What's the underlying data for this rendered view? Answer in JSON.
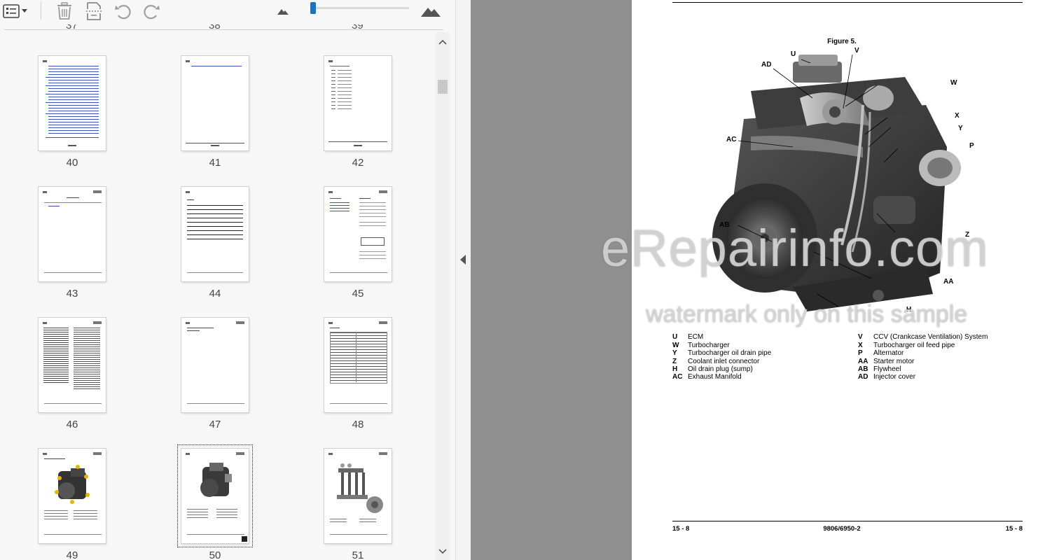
{
  "toolbar": {
    "icons": [
      "list-view-icon",
      "dropdown-caret-icon",
      "delete-icon",
      "extract-page-icon",
      "rotate-left-icon",
      "rotate-right-icon",
      "zoom-out-icon",
      "zoom-in-icon"
    ],
    "zoom_level": 0.02
  },
  "thumbnails": {
    "partial_numbers": [
      "37",
      "38",
      "39"
    ],
    "pages": [
      {
        "number": "40"
      },
      {
        "number": "41"
      },
      {
        "number": "42"
      },
      {
        "number": "43"
      },
      {
        "number": "44"
      },
      {
        "number": "45"
      },
      {
        "number": "46"
      },
      {
        "number": "47"
      },
      {
        "number": "48"
      },
      {
        "number": "49"
      },
      {
        "number": "50"
      },
      {
        "number": "51"
      }
    ],
    "selected": "50"
  },
  "document": {
    "figure_title": "Figure 5.",
    "callouts": [
      "U",
      "V",
      "AD",
      "W",
      "X",
      "Y",
      "AC",
      "P",
      "AB",
      "Z",
      "AA",
      "H"
    ],
    "legend": [
      {
        "code": "U",
        "label": "ECM"
      },
      {
        "code": "W",
        "label": "Turbocharger"
      },
      {
        "code": "Y",
        "label": "Turbocharger oil drain pipe"
      },
      {
        "code": "Z",
        "label": "Coolant inlet connector"
      },
      {
        "code": "H",
        "label": "Oil drain plug (sump)"
      },
      {
        "code": "AC",
        "label": "Exhaust Manifold"
      },
      {
        "code": "V",
        "label": "CCV (Crankcase Ventilation) System"
      },
      {
        "code": "X",
        "label": "Turbocharger oil feed pipe"
      },
      {
        "code": "P",
        "label": "Alternator"
      },
      {
        "code": "AA",
        "label": "Starter motor"
      },
      {
        "code": "AB",
        "label": "Flywheel"
      },
      {
        "code": "AD",
        "label": "Injector cover"
      }
    ],
    "footer_left": "15 - 8",
    "footer_center": "9806/6950-2",
    "footer_right": "15 - 8"
  },
  "watermark": {
    "line1": "eRepairinfo.com",
    "line2": "watermark only on this sample"
  },
  "colors": {
    "accent": "#1a73c8",
    "viewer_background": "#8f8f8f"
  }
}
